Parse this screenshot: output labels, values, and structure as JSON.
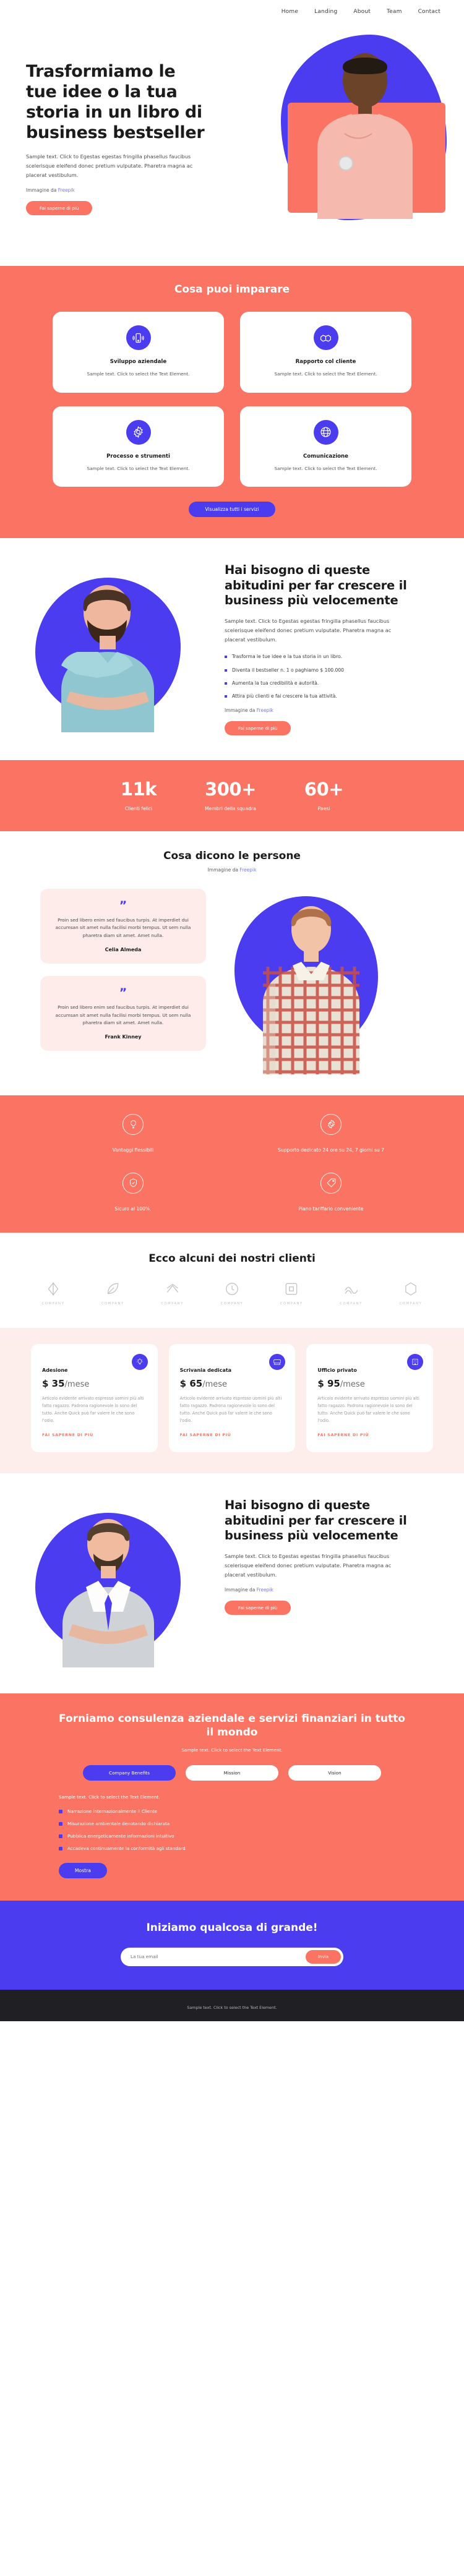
{
  "nav": {
    "items": [
      "Home",
      "Landing",
      "About",
      "Team",
      "Contact"
    ]
  },
  "hero": {
    "title": "Trasformiamo le tue idee o la tua storia in un libro di business bestseller",
    "lead": "Sample text. Click to Egestas egestas fringilla phasellus faucibus scelerisque eleifend donec pretium vulputate. Pharetra magna ac placerat vestibulum.",
    "credit_prefix": "Immagine da ",
    "credit_link": "Freepik",
    "cta": "Fai saperne di più"
  },
  "learn": {
    "title": "Cosa puoi imparare",
    "cards": [
      {
        "icon": "mobile-icon",
        "title": "Sviluppo aziendale",
        "text": "Sample text. Click to select the Text Element."
      },
      {
        "icon": "handshake-icon",
        "title": "Rapporto col cliente",
        "text": "Sample text. Click to select the Text Element."
      },
      {
        "icon": "gear-icon",
        "title": "Processo e strumenti",
        "text": "Sample text. Click to select the Text Element."
      },
      {
        "icon": "globe-icon",
        "title": "Comunicazione",
        "text": "Sample text. Click to select the Text Element."
      }
    ],
    "cta": "Visualizza tutti i servizi"
  },
  "habits": {
    "title": "Hai bisogno di queste abitudini per far crescere il business più velocemente",
    "lead": "Sample text. Click to Egestas egestas fringilla phasellus faucibus scelerisque eleifend donec pretium vulputate. Pharetra magna ac placerat vestibulum.",
    "bullets": [
      "Trasforma le tue idee e la tua storia in un libro.",
      "Diventa il bestseller n. 1 o paghiamo $ 100.000",
      "Aumenta la tua credibilità e autorità.",
      "Attira più clienti e fai crescere la tua attività."
    ],
    "credit_prefix": "Immagine da ",
    "credit_link": "Freepik",
    "cta": "Fai saperne di più"
  },
  "stats": [
    {
      "num": "11k",
      "label": "Clienti felici"
    },
    {
      "num": "300+",
      "label": "Membri della squadra"
    },
    {
      "num": "60+",
      "label": "Paesi"
    }
  ],
  "testimonials": {
    "title": "Cosa dicono le persone",
    "credit_prefix": "Immagine da ",
    "credit_link": "Freepik",
    "quotes": [
      {
        "mark": "”",
        "text": "Proin sed libero enim sed faucibus turpis. At imperdiet dui accumsan sit amet nulla facilisi morbi tempus. Ut sem nulla pharetra diam sit amet. Amet nulla.",
        "author": "Celia Almeda"
      },
      {
        "mark": "”",
        "text": "Proin sed libero enim sed faucibus turpis. At imperdiet dui accumsan sit amet nulla facilisi morbi tempus. Ut sem nulla pharetra diam sit amet. Amet nulla.",
        "author": "Frank Kinney"
      }
    ]
  },
  "benefits": [
    {
      "icon": "lightbulb-icon",
      "label": "Vantaggi flessibili"
    },
    {
      "icon": "gear-icon",
      "label": "Supporto dedicato 24 ore su 24, 7 giorni su 7"
    },
    {
      "icon": "shield-icon",
      "label": "Sicuro al 100%."
    },
    {
      "icon": "tag-icon",
      "label": "Piano tariffario conveniente"
    }
  ],
  "clients": {
    "title": "Ecco alcuni dei nostri clienti",
    "logos": [
      {
        "icon": "diamond-icon",
        "name": "COMPANY"
      },
      {
        "icon": "leaf-icon",
        "name": "COMPANY"
      },
      {
        "icon": "chevron-icon",
        "name": "COMPANY"
      },
      {
        "icon": "clock-icon",
        "name": "COMPANY"
      },
      {
        "icon": "square-icon",
        "name": "COMPANY"
      },
      {
        "icon": "wave-icon",
        "name": "COMPANY"
      },
      {
        "icon": "hex-icon",
        "name": "COMPANY"
      }
    ]
  },
  "pricing": {
    "plans": [
      {
        "icon": "lightbulb-icon",
        "name": "Adesione",
        "currency": "$",
        "amount": "35",
        "period": "/mese",
        "text": "Articolo evidente arrivato espresso uomini più alti fatto ragazzo. Padrona ragionevole lo sono del tutto. Anche Quick può far valere le che sono l'odio.",
        "link": "FAI SAPERNE DI PIÙ"
      },
      {
        "icon": "desk-icon",
        "name": "Scrivania dedicata",
        "currency": "$",
        "amount": "65",
        "period": "/mese",
        "text": "Articolo evidente arrivato espresso uomini più alti fatto ragazzo. Padrona ragionevole lo sono del tutto. Anche Quick può far valere le che sono l'odio.",
        "link": "FAI SAPERNE DI PIÙ"
      },
      {
        "icon": "office-icon",
        "name": "Ufficio privato",
        "currency": "$",
        "amount": "95",
        "period": "/mese",
        "text": "Articolo evidente arrivato espresso uomini più alti fatto ragazzo. Padrona ragionevole lo sono del tutto. Anche Quick può far valere le che sono l'odio.",
        "link": "FAI SAPERNE DI PIÙ"
      }
    ]
  },
  "habits2": {
    "title": "Hai bisogno di queste abitudini per far crescere il business più velocemente",
    "lead": "Sample text. Click to Egestas egestas fringilla phasellus faucibus scelerisque eleifend donec pretium vulputate. Pharetra magna ac placerat vestibulum.",
    "credit_prefix": "Immagine da ",
    "credit_link": "Freepik",
    "cta": "Fai saperne di più"
  },
  "consult": {
    "title": "Forniamo consulenza aziendale e servizi finanziari in tutto il mondo",
    "sub": "Sample text. Click to select the Text Element.",
    "tabs": [
      {
        "label": "Company Benefits",
        "active": true
      },
      {
        "label": "Mission",
        "active": false
      },
      {
        "label": "Vision",
        "active": false
      }
    ],
    "intro": "Sample text. Click to select the Text Element.",
    "items": [
      "Narrazione internazionalmente il Cliente",
      "Misurazione ambientale denotando dichiarata",
      "Pubblica energeticamente informazioni intuitivo",
      "Accadeva continuamente la conformità agli standard"
    ],
    "cta": "Mostra"
  },
  "cta": {
    "title": "Iniziamo qualcosa di grande!",
    "placeholder": "La tua email",
    "value": "",
    "button": "Invia"
  },
  "footer": {
    "text": "Sample text. Click to select the Text Element."
  },
  "colors": {
    "salmon": "#fb7463",
    "blue": "#4b3cf0",
    "pink": "#fdeeec",
    "dark": "#1f1f24"
  }
}
